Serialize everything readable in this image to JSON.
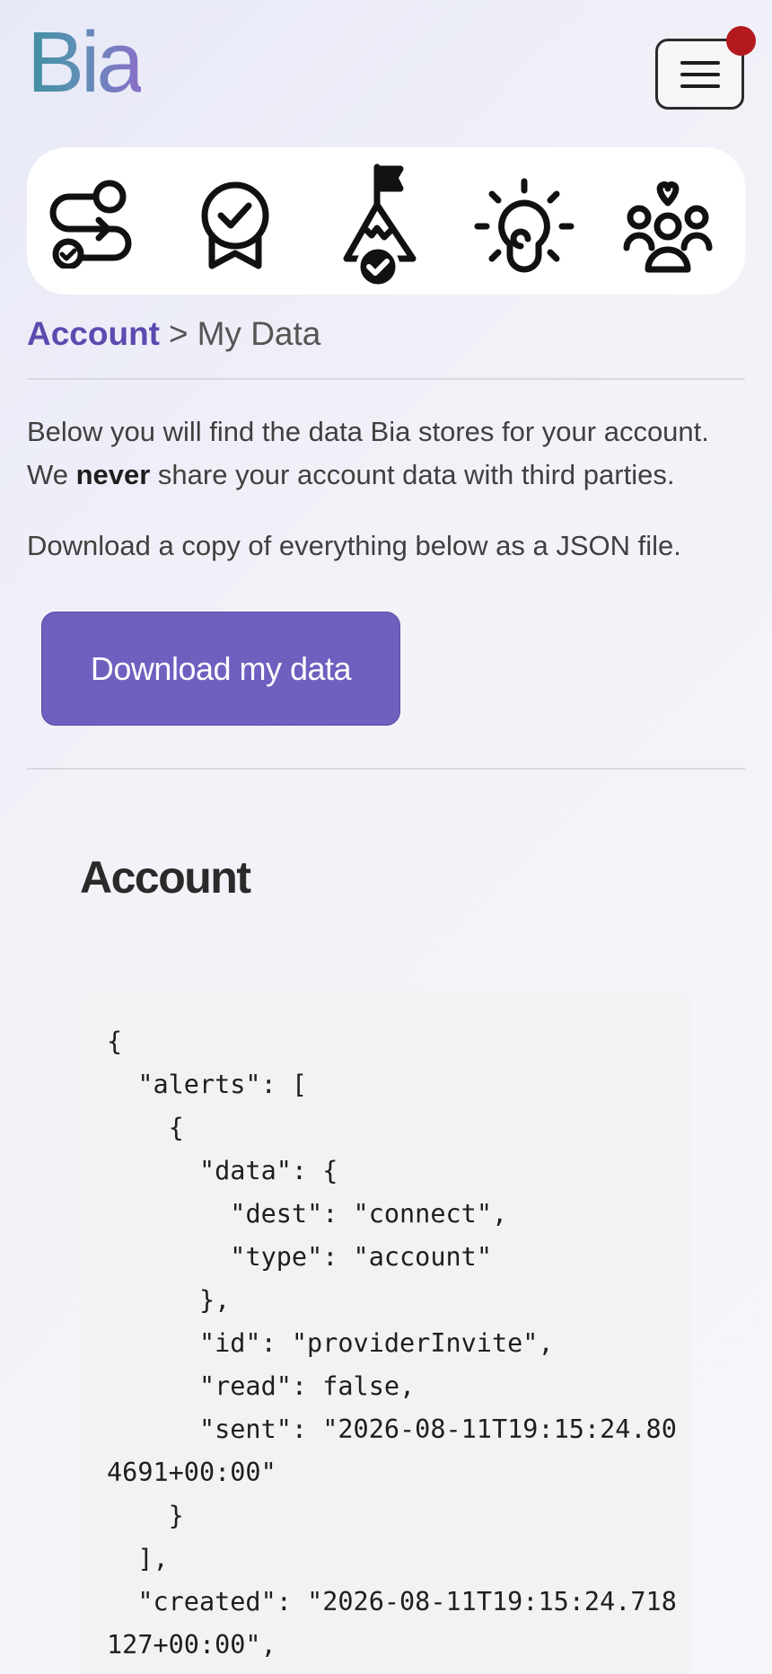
{
  "header": {
    "logo_text": "Bia",
    "menu_button_label": "Open menu"
  },
  "nav_icons": [
    {
      "name": "route-icon",
      "label": "Journey"
    },
    {
      "name": "award-ribbon-icon",
      "label": "Achievements"
    },
    {
      "name": "summit-flag-icon",
      "label": "Goals"
    },
    {
      "name": "lightbulb-icon",
      "label": "Insights"
    },
    {
      "name": "community-icon",
      "label": "Community"
    }
  ],
  "breadcrumb": {
    "parent": "Account",
    "separator": ">",
    "current": "My Data"
  },
  "intro": {
    "line1": "Below you will find the data Bia stores for your account.",
    "line2_prefix": "We ",
    "line2_bold": "never",
    "line2_suffix": " share your account data with third parties."
  },
  "download": {
    "note": "Download a copy of everything below as a JSON file.",
    "button_label": "Download my data"
  },
  "account_section": {
    "title": "Account",
    "json_preview": "{\n  \"alerts\": [\n    {\n      \"data\": {\n        \"dest\": \"connect\",\n        \"type\": \"account\"\n      },\n      \"id\": \"providerInvite\",\n      \"read\": false,\n      \"sent\": \"2026-08-11T19:15:24.804691+00:00\"\n    }\n  ],\n  \"created\": \"2026-08-11T19:15:24.718127+00:00\","
  },
  "colors": {
    "accent": "#6f5fbf",
    "breadcrumb_link": "#5b4bb0",
    "notification_dot": "#b4191d",
    "logo_gradient_start": "#3f8fa1",
    "logo_gradient_end": "#8a6fc9"
  }
}
